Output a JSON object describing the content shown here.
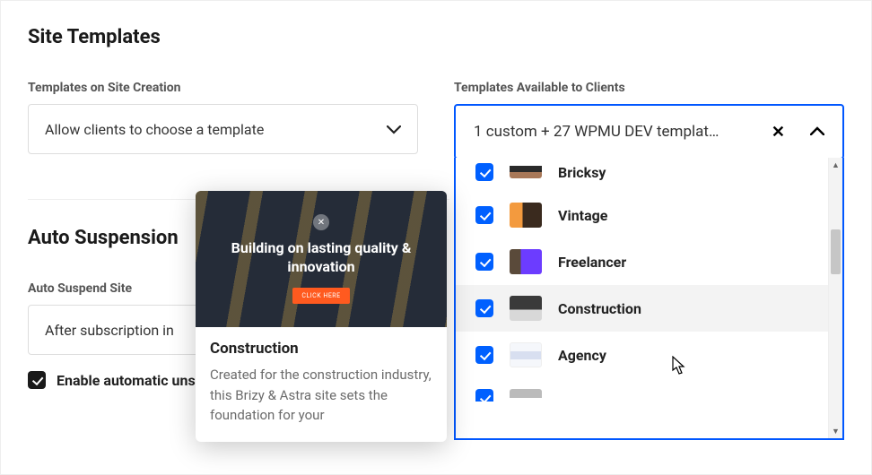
{
  "page_title": "Site Templates",
  "templates_creation": {
    "label": "Templates on Site Creation",
    "selected": "Allow clients to choose a template"
  },
  "templates_available": {
    "label": "Templates Available to Clients",
    "selected_summary": "1 custom + 27 WPMU DEV templat…",
    "options": [
      {
        "label": "Bricksy",
        "checked": true,
        "thumb": "bricksy"
      },
      {
        "label": "Vintage",
        "checked": true,
        "thumb": "vintage"
      },
      {
        "label": "Freelancer",
        "checked": true,
        "thumb": "freelancer"
      },
      {
        "label": "Construction",
        "checked": true,
        "thumb": "construction",
        "highlight": true
      },
      {
        "label": "Agency",
        "checked": true,
        "thumb": "agency"
      }
    ]
  },
  "auto_suspension": {
    "title": "Auto Suspension",
    "suspend_label": "Auto Suspend Site",
    "suspend_value": "After subscription in",
    "checkbox_label": "Enable automatic unsuspension when the pending in"
  },
  "tooltip": {
    "hero_line": "Building on lasting quality & innovation",
    "cta": "CLICK HERE",
    "title": "Construction",
    "description": "Created for the construction industry, this Brizy & Astra site sets the foundation for your"
  }
}
